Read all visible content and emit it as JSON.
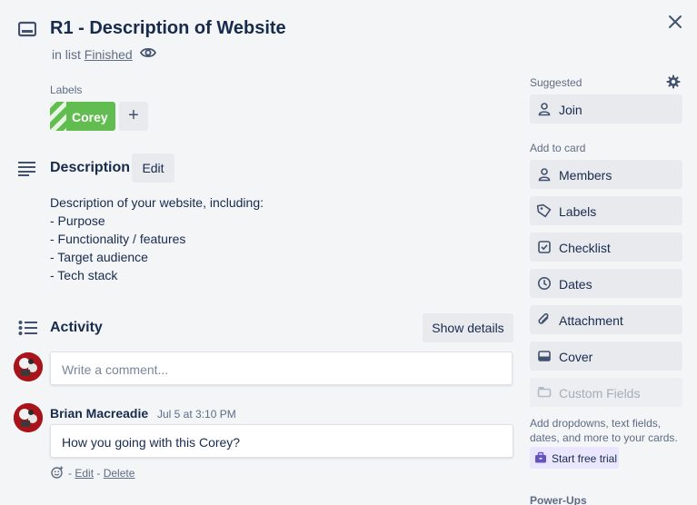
{
  "card": {
    "title": "R1 - Description of Website",
    "in_list_prefix": "in list",
    "list_name": "Finished"
  },
  "labels": {
    "heading": "Labels",
    "items": [
      {
        "name": "Corey",
        "color": "#61bd4f"
      }
    ],
    "add_label": "+"
  },
  "description": {
    "heading": "Description",
    "edit_label": "Edit",
    "lines": [
      "Description of your website, including:",
      "- Purpose",
      "- Functionality / features",
      "- Target audience",
      "- Tech stack"
    ]
  },
  "activity": {
    "heading": "Activity",
    "show_details_label": "Show details",
    "comment_placeholder": "Write a comment...",
    "comments": [
      {
        "author": "Brian Macreadie",
        "time": "Jul 5 at 3:10 PM",
        "text": "How you going with this Corey?",
        "separator": "-",
        "edit_label": "Edit",
        "delete_label": "Delete"
      }
    ]
  },
  "sidebar": {
    "suggested_heading": "Suggested",
    "join_label": "Join",
    "add_to_card_heading": "Add to card",
    "buttons": [
      {
        "label": "Members",
        "icon": "person-icon"
      },
      {
        "label": "Labels",
        "icon": "tag-icon"
      },
      {
        "label": "Checklist",
        "icon": "checkbox-icon"
      },
      {
        "label": "Dates",
        "icon": "clock-icon"
      },
      {
        "label": "Attachment",
        "icon": "paperclip-icon"
      },
      {
        "label": "Cover",
        "icon": "cover-icon"
      },
      {
        "label": "Custom Fields",
        "icon": "custom-fields-icon",
        "disabled": true
      }
    ],
    "upsell_text": "Add dropdowns, text fields, dates, and more to your cards.",
    "trial_label": "Start free trial",
    "powerups_heading": "Power-Ups"
  },
  "colors": {
    "background": "#f4f5f7",
    "button": "#e8eaee",
    "label_green": "#61bd4f",
    "trial_bg": "#eae6ff",
    "text": "#172b4d",
    "muted": "#5e6c84"
  }
}
